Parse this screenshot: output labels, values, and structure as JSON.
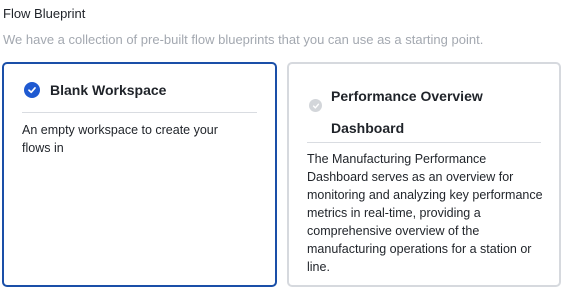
{
  "section": {
    "title": "Flow Blueprint",
    "description": "We have a collection of pre-built flow blueprints that you can use as a starting point."
  },
  "cards": [
    {
      "title": "Blank Workspace",
      "description": "An empty workspace to create your flows in",
      "selected": true
    },
    {
      "title": "Performance Overview Dashboard",
      "description": "The Manufacturing Performance Dashboard serves as an overview for monitoring and analyzing key performance metrics in real-time, providing a comprehensive overview of the manufacturing operations for a station or line.",
      "selected": false
    }
  ],
  "colors": {
    "accent": "#1f5ad1",
    "selected_border": "#1a4fa8",
    "unselected_border": "#d6d9de",
    "muted_text": "#a3a8b0"
  },
  "icons": {
    "selected": "check-circle-icon",
    "unselected": "check-circle-icon"
  }
}
